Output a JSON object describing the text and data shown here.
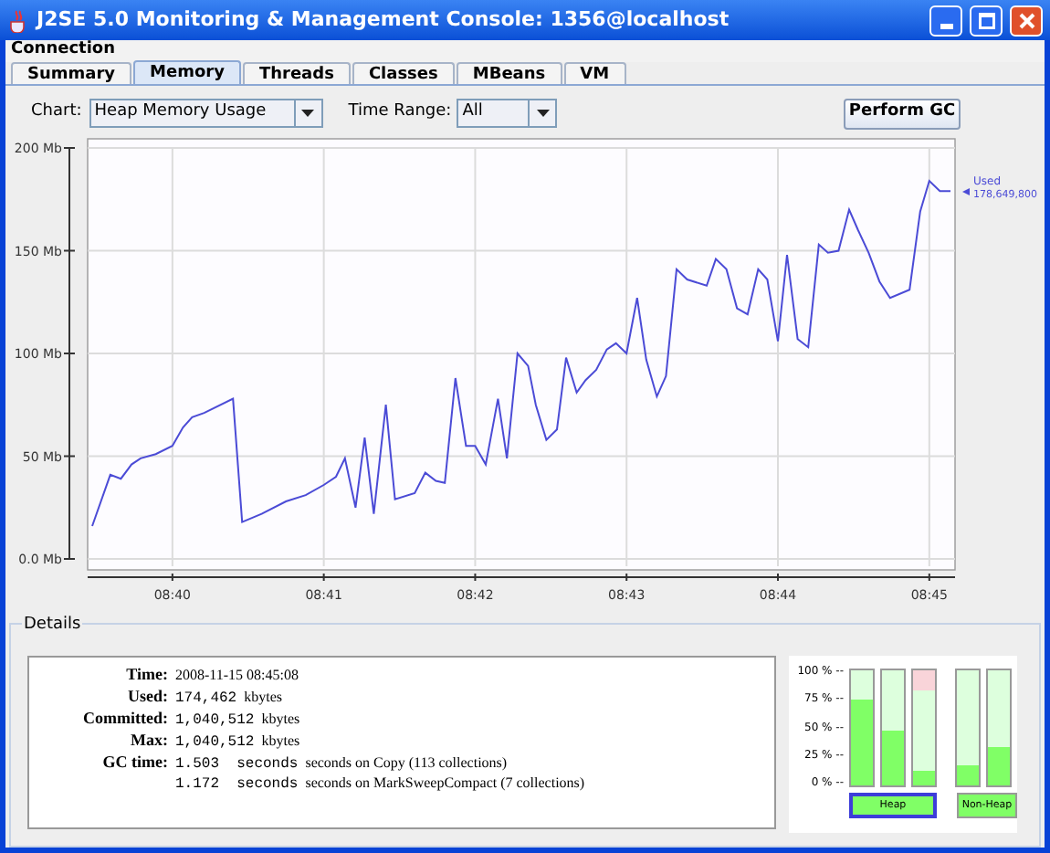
{
  "window": {
    "title": "J2SE 5.0 Monitoring & Management Console: 1356@localhost"
  },
  "menu": [
    "Connection"
  ],
  "tabs": [
    {
      "label": "Summary",
      "selected": false
    },
    {
      "label": "Memory",
      "selected": true
    },
    {
      "label": "Threads",
      "selected": false
    },
    {
      "label": "Classes",
      "selected": false
    },
    {
      "label": "MBeans",
      "selected": false
    },
    {
      "label": "VM",
      "selected": false
    }
  ],
  "chart_selector": {
    "label": "Chart:",
    "value": "Heap Memory Usage"
  },
  "time_range": {
    "label": "Time Range:",
    "value": "All"
  },
  "gc_button": "Perform GC",
  "memory_chart": {
    "legend": {
      "value": "178,649,800"
    },
    "chart_data": {
      "type": "line",
      "grid": true,
      "xlim": [
        519.44,
        525.17
      ],
      "ylim": [
        0,
        200
      ],
      "xticks": [
        {
          "value": 520,
          "label": "08:40"
        },
        {
          "value": 521,
          "label": "08:41"
        },
        {
          "value": 522,
          "label": "08:42"
        },
        {
          "value": 523,
          "label": "08:43"
        },
        {
          "value": 524,
          "label": "08:44"
        },
        {
          "value": 525,
          "label": "08:45"
        }
      ],
      "yticks": [
        {
          "value": 0,
          "label": "0.0 Mb"
        },
        {
          "value": 50,
          "label": "50 Mb"
        },
        {
          "value": 100,
          "label": "100 Mb"
        },
        {
          "value": 150,
          "label": "150 Mb"
        },
        {
          "value": 200,
          "label": "200 Mb"
        }
      ],
      "x": [
        519.47,
        519.59,
        519.66,
        519.73,
        519.79,
        519.89,
        520.0,
        520.07,
        520.13,
        520.21,
        520.4,
        520.46,
        520.59,
        520.75,
        520.88,
        521.0,
        521.08,
        521.14,
        521.21,
        521.27,
        521.33,
        521.41,
        521.47,
        521.6,
        521.67,
        521.74,
        521.8,
        521.87,
        521.94,
        522.0,
        522.07,
        522.15,
        522.21,
        522.28,
        522.35,
        522.4,
        522.47,
        522.54,
        522.6,
        522.67,
        522.73,
        522.8,
        522.87,
        522.93,
        523.0,
        523.07,
        523.13,
        523.2,
        523.26,
        523.33,
        523.4,
        523.53,
        523.59,
        523.66,
        523.73,
        523.8,
        523.87,
        523.93,
        524.0,
        524.06,
        524.13,
        524.2,
        524.27,
        524.33,
        524.4,
        524.47,
        524.53,
        524.6,
        524.67,
        524.74,
        524.87,
        524.94,
        525.0,
        525.07,
        525.14
      ],
      "series": [
        {
          "name": "Used",
          "color": "#4b4bd6",
          "values": [
            16,
            41,
            39,
            46,
            49,
            51,
            55,
            64,
            69,
            71,
            78,
            18,
            22,
            28,
            31,
            36,
            40,
            49,
            25,
            59,
            22,
            75,
            29,
            32,
            42,
            38,
            37,
            88,
            55,
            55,
            46,
            78,
            49,
            100,
            94,
            75,
            58,
            63,
            98,
            81,
            87,
            92,
            102,
            105,
            100,
            127,
            97,
            79,
            89,
            141,
            136,
            133,
            146,
            141,
            122,
            119,
            141,
            136,
            106,
            148,
            107,
            103,
            153,
            149,
            150,
            170,
            160,
            149,
            135,
            127,
            131,
            169,
            184,
            179,
            179
          ]
        }
      ]
    }
  },
  "details": {
    "title": "Details",
    "rows": [
      {
        "label": "Time:",
        "text": "2008-11-15 08:45:08"
      },
      {
        "label": "Used:",
        "number": "174,462",
        "text": "kbytes"
      },
      {
        "label": "Committed:",
        "number": "1,040,512",
        "text": "kbytes"
      },
      {
        "label": "Max:",
        "number": "1,040,512",
        "text": "kbytes"
      },
      {
        "label": "GC time:",
        "number": "1.503  seconds",
        "text": "seconds on Copy (113 collections)"
      },
      {
        "number": "1.172  seconds",
        "text": "seconds on MarkSweepCompact (7 collections)"
      }
    ]
  },
  "pools": {
    "scale": [
      "100 % --",
      "75 % --",
      "50 % --",
      "25 % --",
      "0 % --"
    ],
    "bars": [
      {
        "level": 0.74,
        "alert": false
      },
      {
        "level": 0.47,
        "alert": false
      },
      {
        "level": 0.12,
        "alert": true
      },
      {
        "level": 0.17,
        "alert": false
      },
      {
        "level": 0.33,
        "alert": false
      }
    ],
    "groups": [
      {
        "label": "Heap",
        "selected": true
      },
      {
        "label": "Non-Heap",
        "selected": false
      }
    ]
  }
}
